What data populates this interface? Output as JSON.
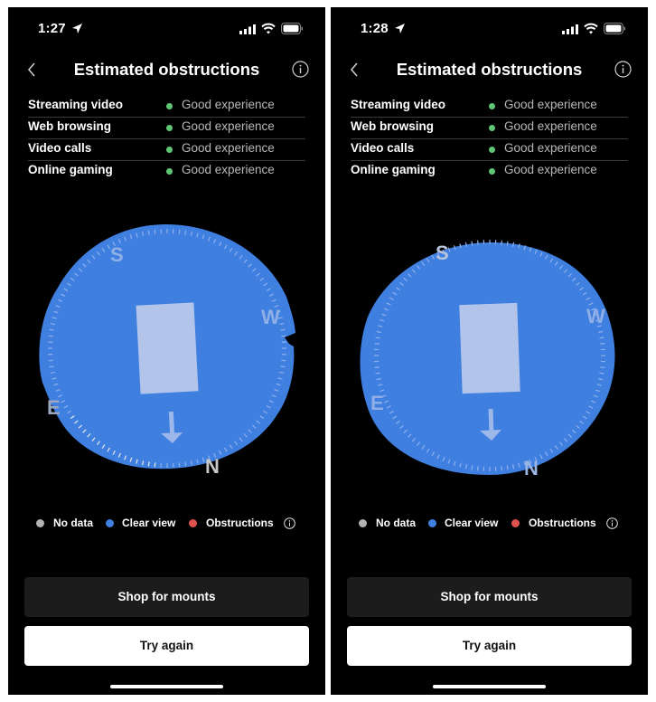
{
  "colors": {
    "background": "#000000",
    "clear_view": "#3f7fe0",
    "dish": "#b2c4ea",
    "good": "#5fc675",
    "no_data": "#b3b3b3",
    "obstructions": "#e0504f",
    "secondary_button": "#1c1c1c",
    "primary_button": "#ffffff"
  },
  "screens": [
    {
      "status_bar": {
        "time": "1:27",
        "icons": [
          "location-arrow-icon",
          "cellular-signal-icon",
          "wifi-icon",
          "battery-icon"
        ]
      },
      "nav": {
        "back_icon": "chevron-left-icon",
        "title": "Estimated obstructions",
        "info_icon": "info-circle-icon"
      },
      "quality": [
        {
          "label": "Streaming video",
          "status": "Good experience"
        },
        {
          "label": "Web browsing",
          "status": "Good experience"
        },
        {
          "label": "Video calls",
          "status": "Good experience"
        },
        {
          "label": "Online gaming",
          "status": "Good experience"
        }
      ],
      "compass": {
        "labels": {
          "n": "N",
          "s": "S",
          "e": "E",
          "w": "W"
        },
        "direction_arrow": "arrow-down-icon",
        "obstructions_detected": false,
        "no_data_region": "south-west arc near N"
      },
      "legend": [
        {
          "label": "No data",
          "color_key": "no_data"
        },
        {
          "label": "Clear view",
          "color_key": "clear_view"
        },
        {
          "label": "Obstructions",
          "color_key": "obstructions"
        }
      ],
      "buttons": {
        "shop": "Shop for mounts",
        "retry": "Try again"
      }
    },
    {
      "status_bar": {
        "time": "1:28",
        "icons": [
          "location-arrow-icon",
          "cellular-signal-icon",
          "wifi-icon",
          "battery-icon"
        ]
      },
      "nav": {
        "back_icon": "chevron-left-icon",
        "title": "Estimated obstructions",
        "info_icon": "info-circle-icon"
      },
      "quality": [
        {
          "label": "Streaming video",
          "status": "Good experience"
        },
        {
          "label": "Web browsing",
          "status": "Good experience"
        },
        {
          "label": "Video calls",
          "status": "Good experience"
        },
        {
          "label": "Online gaming",
          "status": "Good experience"
        }
      ],
      "compass": {
        "labels": {
          "n": "N",
          "s": "S",
          "e": "E",
          "w": "W"
        },
        "direction_arrow": "arrow-down-icon",
        "obstructions_detected": false,
        "no_data_region": "none"
      },
      "legend": [
        {
          "label": "No data",
          "color_key": "no_data"
        },
        {
          "label": "Clear view",
          "color_key": "clear_view"
        },
        {
          "label": "Obstructions",
          "color_key": "obstructions"
        }
      ],
      "buttons": {
        "shop": "Shop for mounts",
        "retry": "Try again"
      }
    }
  ]
}
